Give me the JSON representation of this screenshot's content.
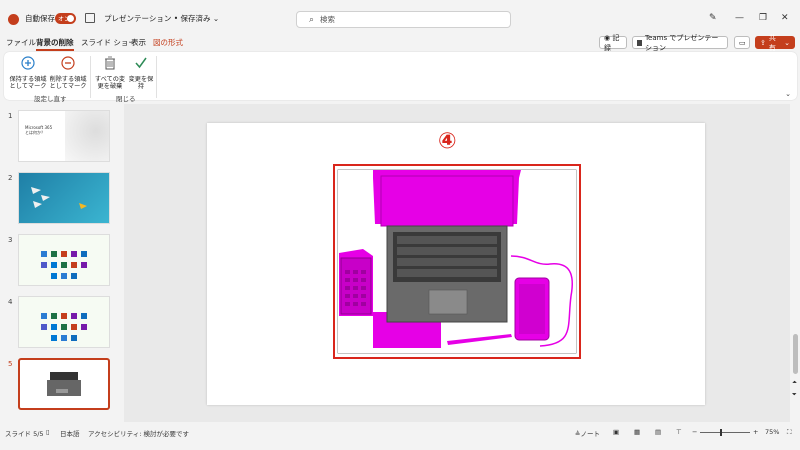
{
  "titlebar": {
    "autosave_label": "自動保存",
    "autosave_state": "オン",
    "doc_title": "プレゼンテーション • 保存済み ⌄",
    "search_placeholder": "検索"
  },
  "tabs": [
    "ファイル",
    "背景の削除",
    "スライド ショー",
    "表示",
    "図の形式"
  ],
  "ribbon_right": {
    "record_label": "◉ 記録",
    "teams_label": "Teams でプレゼンテーション",
    "share_label": "共有"
  },
  "ribbon": {
    "btn_keep": "保持する領域としてマーク",
    "btn_remove": "削除する領域としてマーク",
    "btn_discard": "すべての変更を破棄",
    "btn_save": "変更を保持",
    "group_refine": "設定し直す",
    "group_close": "閉じる"
  },
  "thumbs": {
    "n1": "1",
    "n2": "2",
    "n3": "3",
    "n4": "4",
    "n5": "5",
    "t1_title": "Microsoft 365\nとは何か？"
  },
  "slide": {
    "marker": "④"
  },
  "statusbar": {
    "slide_info": "スライド 5/5",
    "language": "日本語",
    "accessibility": "アクセシビリティ: 検討が必要です",
    "notes": "ノート",
    "zoom": "75%"
  },
  "colors": {
    "accent": "#c43e1c",
    "highlight_frame": "#d9261c",
    "removal_magenta": "#e600e6"
  }
}
